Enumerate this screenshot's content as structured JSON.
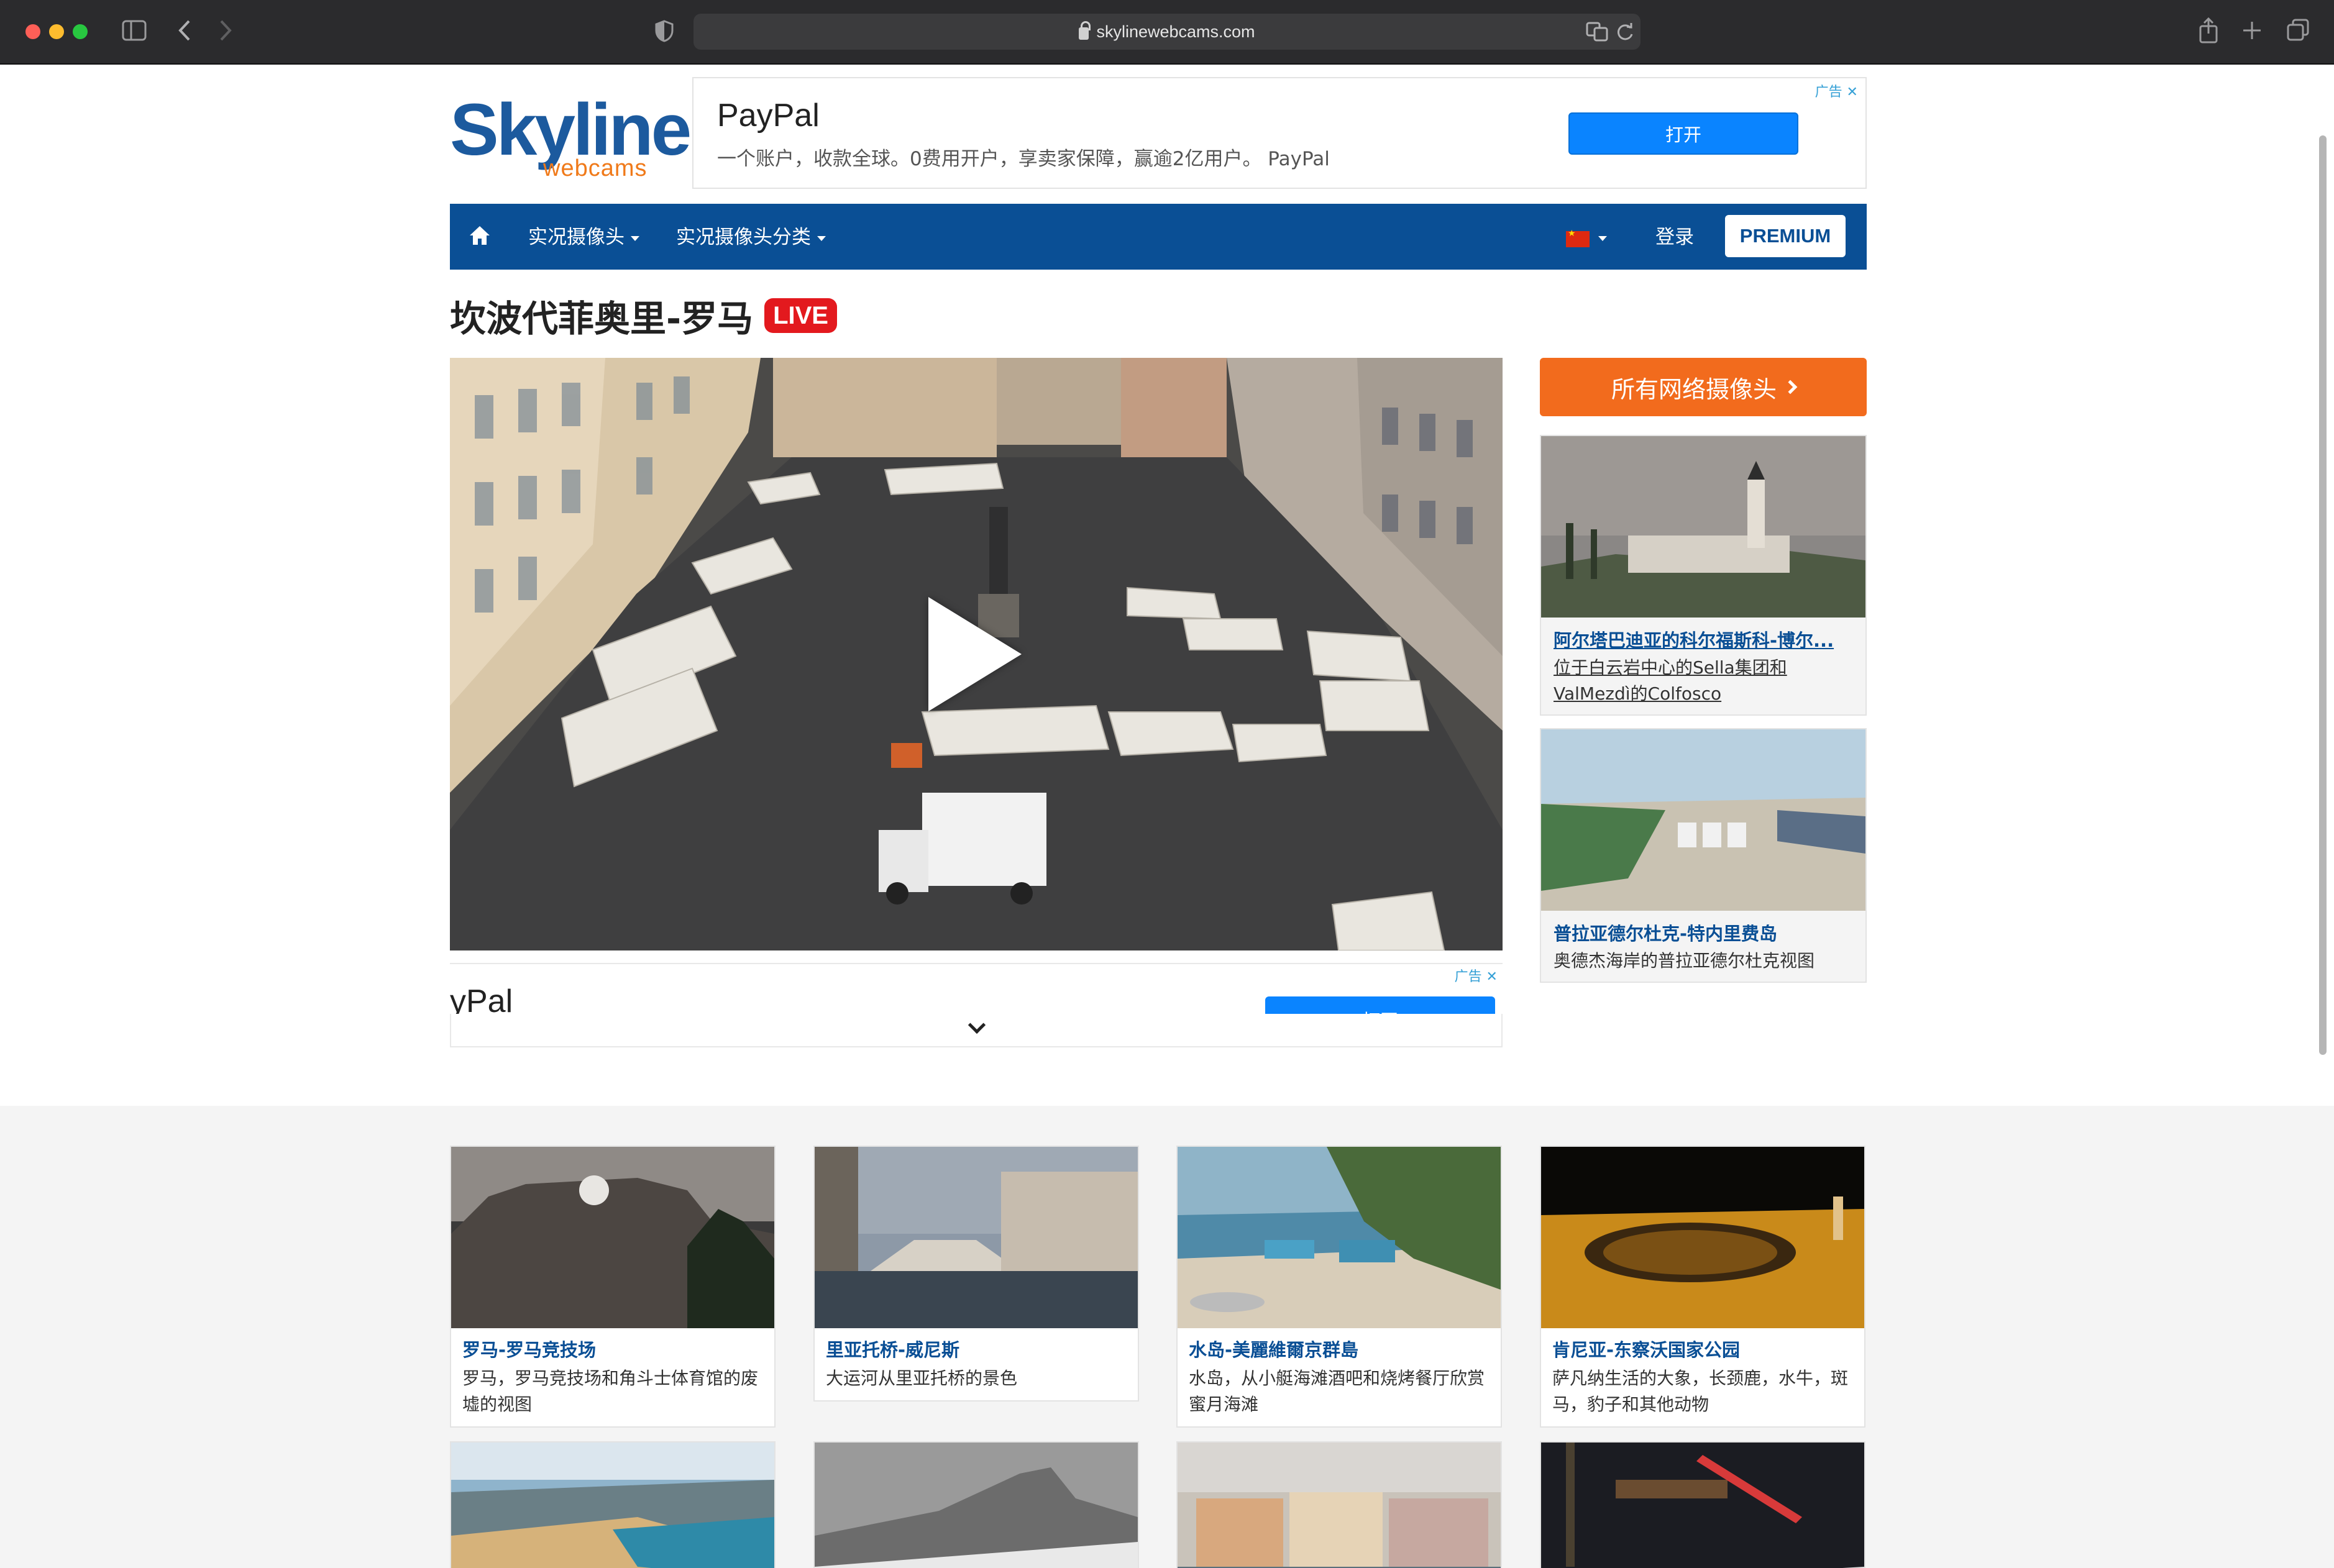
{
  "browser": {
    "url": "skylinewebcams.com"
  },
  "logo": {
    "main": "Skyline",
    "sub": "webcams"
  },
  "ad_top": {
    "brand": "PayPal",
    "text": "一个账户，收款全球。0费用开户，享卖家保障，赢逾2亿用户。 PayPal",
    "button": "打开",
    "tag": "广告 ✕"
  },
  "nav": {
    "live_cams": "实况摄像头",
    "categories": "实况摄像头分类",
    "login": "登录",
    "premium": "PREMIUM"
  },
  "page": {
    "title": "坎波代菲奥里-罗马",
    "live_badge": "LIVE"
  },
  "ad_bottom": {
    "brand": "yPal",
    "button": "打开",
    "tag": "广告 ✕"
  },
  "sidebar": {
    "all_button": "所有网络摄像头",
    "cards": [
      {
        "title": "阿尔塔巴迪亚的科尔福斯科-博尔...",
        "desc": "位于白云岩中心的Sella集团和ValMezdì的Colfosco"
      },
      {
        "title": "普拉亚德尔杜克-特内里费岛",
        "desc": "奥德杰海岸的普拉亚德尔杜克视图"
      }
    ]
  },
  "grid": [
    {
      "title": "罗马-罗马竞技场",
      "desc": "罗马，罗马竞技场和角斗士体育馆的废墟的视图"
    },
    {
      "title": "里亚托桥-威尼斯",
      "desc": "大运河从里亚托桥的景色"
    },
    {
      "title": "水岛-美麗維爾京群島",
      "desc": "水岛，从小艇海滩酒吧和烧烤餐厅欣赏蜜月海滩"
    },
    {
      "title": "肯尼亚-东察沃国家公园",
      "desc": "萨凡纳生活的大象，长颈鹿，水牛，斑马，豹子和其他动物"
    }
  ]
}
